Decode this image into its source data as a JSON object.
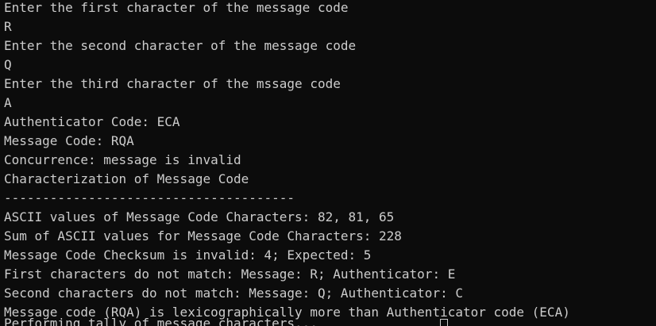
{
  "console": {
    "colors": {
      "background": "#0c0c0c",
      "foreground": "#cccccc"
    },
    "lines": [
      "Enter the first character of the message code",
      "R",
      "Enter the second character of the message code",
      "Q",
      "Enter the third character of the mssage code",
      "A",
      "Authenticator Code: ECA",
      "Message Code: RQA",
      "Concurrence: message is invalid",
      "Characterization of Message Code",
      "--------------------------------------",
      "ASCII values of Message Code Characters: 82, 81, 65",
      "Sum of ASCII values for Message Code Characters: 228",
      "Message Code Checksum is invalid: 4; Expected: 5",
      "First characters do not match: Message: R; Authenticator: E",
      "Second characters do not match: Message: Q; Authenticator: C",
      "Message code (RQA) is lexicographically more than Authenticator code (ECA)"
    ],
    "cutoff_line": "Performing tally of message characters...",
    "cursor_icon": "block-cursor-icon"
  }
}
